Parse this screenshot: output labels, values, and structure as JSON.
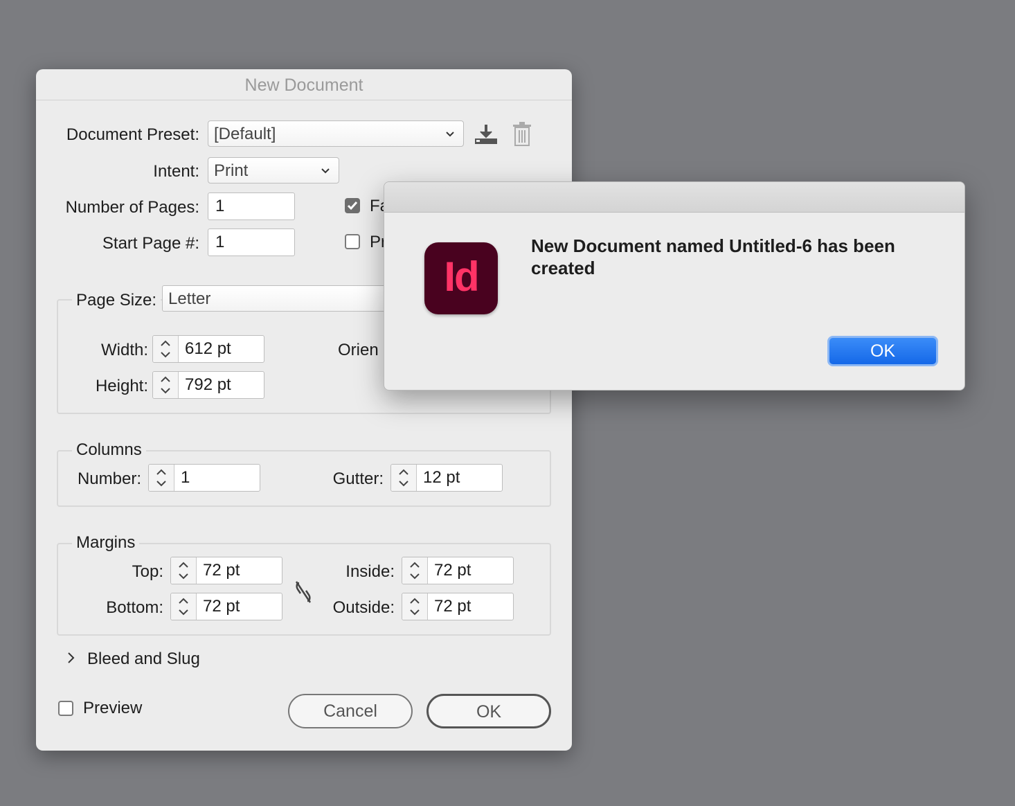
{
  "dialog": {
    "title": "New Document",
    "preset_label": "Document Preset:",
    "preset_value": "[Default]",
    "intent_label": "Intent:",
    "intent_value": "Print",
    "pages_label": "Number of Pages:",
    "pages_value": "1",
    "start_label": "Start Page #:",
    "start_value": "1",
    "facing_label": "Fa",
    "facing_checked": true,
    "primary_label": "Pr",
    "primary_checked": false,
    "page_size_label": "Page Size:",
    "page_size_value": "Letter",
    "width_label": "Width:",
    "width_value": "612 pt",
    "height_label": "Height:",
    "height_value": "792 pt",
    "orientation_label": "Orien",
    "columns": {
      "title": "Columns",
      "number_label": "Number:",
      "number_value": "1",
      "gutter_label": "Gutter:",
      "gutter_value": "12 pt"
    },
    "margins": {
      "title": "Margins",
      "top_label": "Top:",
      "top_value": "72 pt",
      "bottom_label": "Bottom:",
      "bottom_value": "72 pt",
      "inside_label": "Inside:",
      "inside_value": "72 pt",
      "outside_label": "Outside:",
      "outside_value": "72 pt"
    },
    "bleed_label": "Bleed and Slug",
    "preview_label": "Preview",
    "preview_checked": false,
    "cancel_label": "Cancel",
    "ok_label": "OK"
  },
  "alert": {
    "app_icon_text": "Id",
    "message": "New Document named Untitled-6 has been created",
    "ok_label": "OK"
  },
  "colors": {
    "backdrop": "#7b7c80",
    "indesign_icon_bg": "#49021f",
    "indesign_icon_text": "#ff3366",
    "default_button": "#1468e8"
  },
  "icons": [
    "chevron-down-icon",
    "save-preset-icon",
    "trash-icon",
    "stepper-icon",
    "unlink-icon",
    "chevron-right-icon",
    "checkmark-icon",
    "indesign-app-icon"
  ]
}
